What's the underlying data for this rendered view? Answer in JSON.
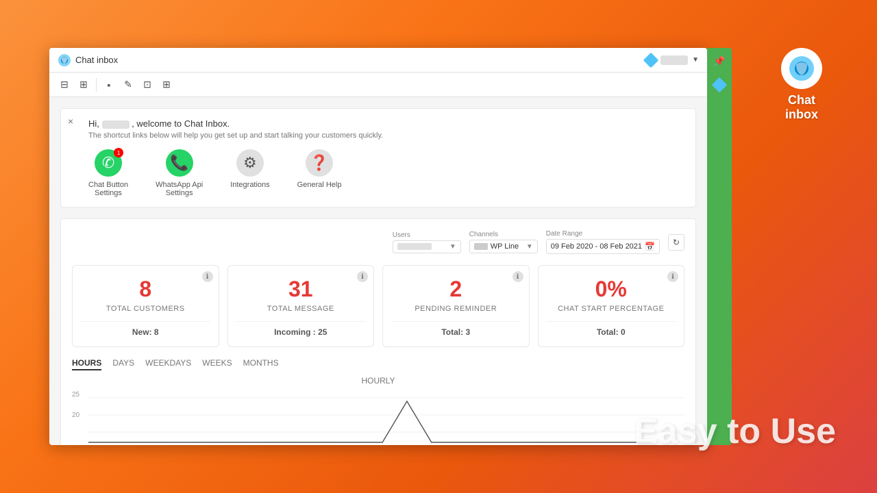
{
  "app": {
    "title": "Chat inbox",
    "window": {
      "toolbar_icons": [
        "grid-icon",
        "tiles-icon",
        "bar-chart-icon",
        "edit-icon",
        "image-icon",
        "box-icon"
      ]
    }
  },
  "welcome": {
    "close_label": "×",
    "greeting": "Hi,",
    "username_placeholder": "user",
    "welcome_text": ", welcome to Chat Inbox.",
    "subtitle": "The shortcut links below will help you get set up and start talking your customers quickly."
  },
  "quick_links": [
    {
      "id": "chat-button-settings",
      "label": "Chat Button\nSettings",
      "icon": "whatsapp",
      "badge": "1"
    },
    {
      "id": "whatsapp-api-settings",
      "label": "WhatsApp Api\nSettings",
      "icon": "whatsapp",
      "badge": null
    },
    {
      "id": "integrations",
      "label": "Integrations",
      "icon": "gear",
      "badge": null
    },
    {
      "id": "general-help",
      "label": "General Help",
      "icon": "help",
      "badge": null
    }
  ],
  "filters": {
    "users_label": "Users",
    "channels_label": "Channels",
    "channels_value": "WP Line",
    "date_range_label": "Date Range",
    "date_range_value": "09 Feb 2020 - 08 Feb 2021"
  },
  "stats": [
    {
      "value": "8",
      "label": "TOTAL CUSTOMERS",
      "sub_key": "New:",
      "sub_value": "8"
    },
    {
      "value": "31",
      "label": "TOTAL MESSAGE",
      "sub_key": "Incoming :",
      "sub_value": "25"
    },
    {
      "value": "2",
      "label": "PENDING REMINDER",
      "sub_key": "Total:",
      "sub_value": "3"
    },
    {
      "value": "0%",
      "label": "CHAT START PERCENTAGE",
      "sub_key": "Total:",
      "sub_value": "0"
    }
  ],
  "chart": {
    "tabs": [
      "HOURS",
      "DAYS",
      "WEEKDAYS",
      "WEEKS",
      "MONTHS"
    ],
    "active_tab": "HOURS",
    "title": "HOURLY",
    "y_labels": [
      "25",
      "20"
    ],
    "data_points": [
      0,
      0,
      0,
      0,
      0,
      0,
      0,
      0,
      0,
      0,
      0,
      0,
      0,
      22,
      0,
      0,
      0,
      0,
      0,
      0,
      0,
      0,
      0,
      0
    ]
  },
  "sidebar_right": {
    "pin_icon": "📌",
    "diamond_color": "#4fc3f7"
  },
  "chat_inbox_logo": {
    "title": "Chat\ninbox"
  },
  "promo": {
    "text": "Easy to Use"
  }
}
